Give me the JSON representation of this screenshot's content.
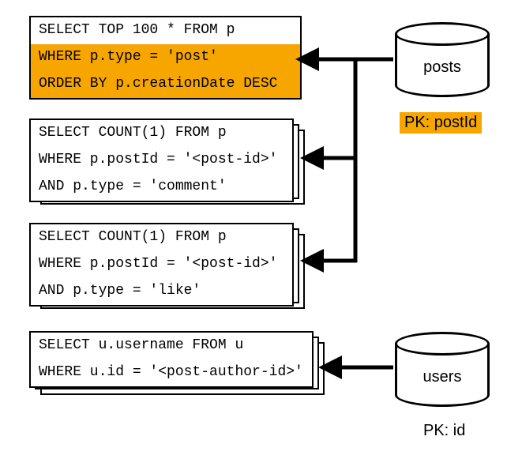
{
  "queries": {
    "q1": {
      "line1": "SELECT TOP 100 * FROM p",
      "line2": "WHERE p.type = 'post'",
      "line3": "ORDER BY p.creationDate DESC"
    },
    "q2": {
      "line1": "SELECT COUNT(1) FROM p",
      "line2": "WHERE p.postId = '<post-id>'",
      "line3": "AND p.type = 'comment'"
    },
    "q3": {
      "line1": "SELECT COUNT(1) FROM p",
      "line2": "WHERE p.postId = '<post-id>'",
      "line3": "AND p.type = 'like'"
    },
    "q4": {
      "line1": "SELECT u.username FROM u",
      "line2": "WHERE u.id = '<post-author-id>'"
    }
  },
  "databases": {
    "posts": {
      "name": "posts",
      "pk": "PK: postId"
    },
    "users": {
      "name": "users",
      "pk": "PK: id"
    }
  }
}
